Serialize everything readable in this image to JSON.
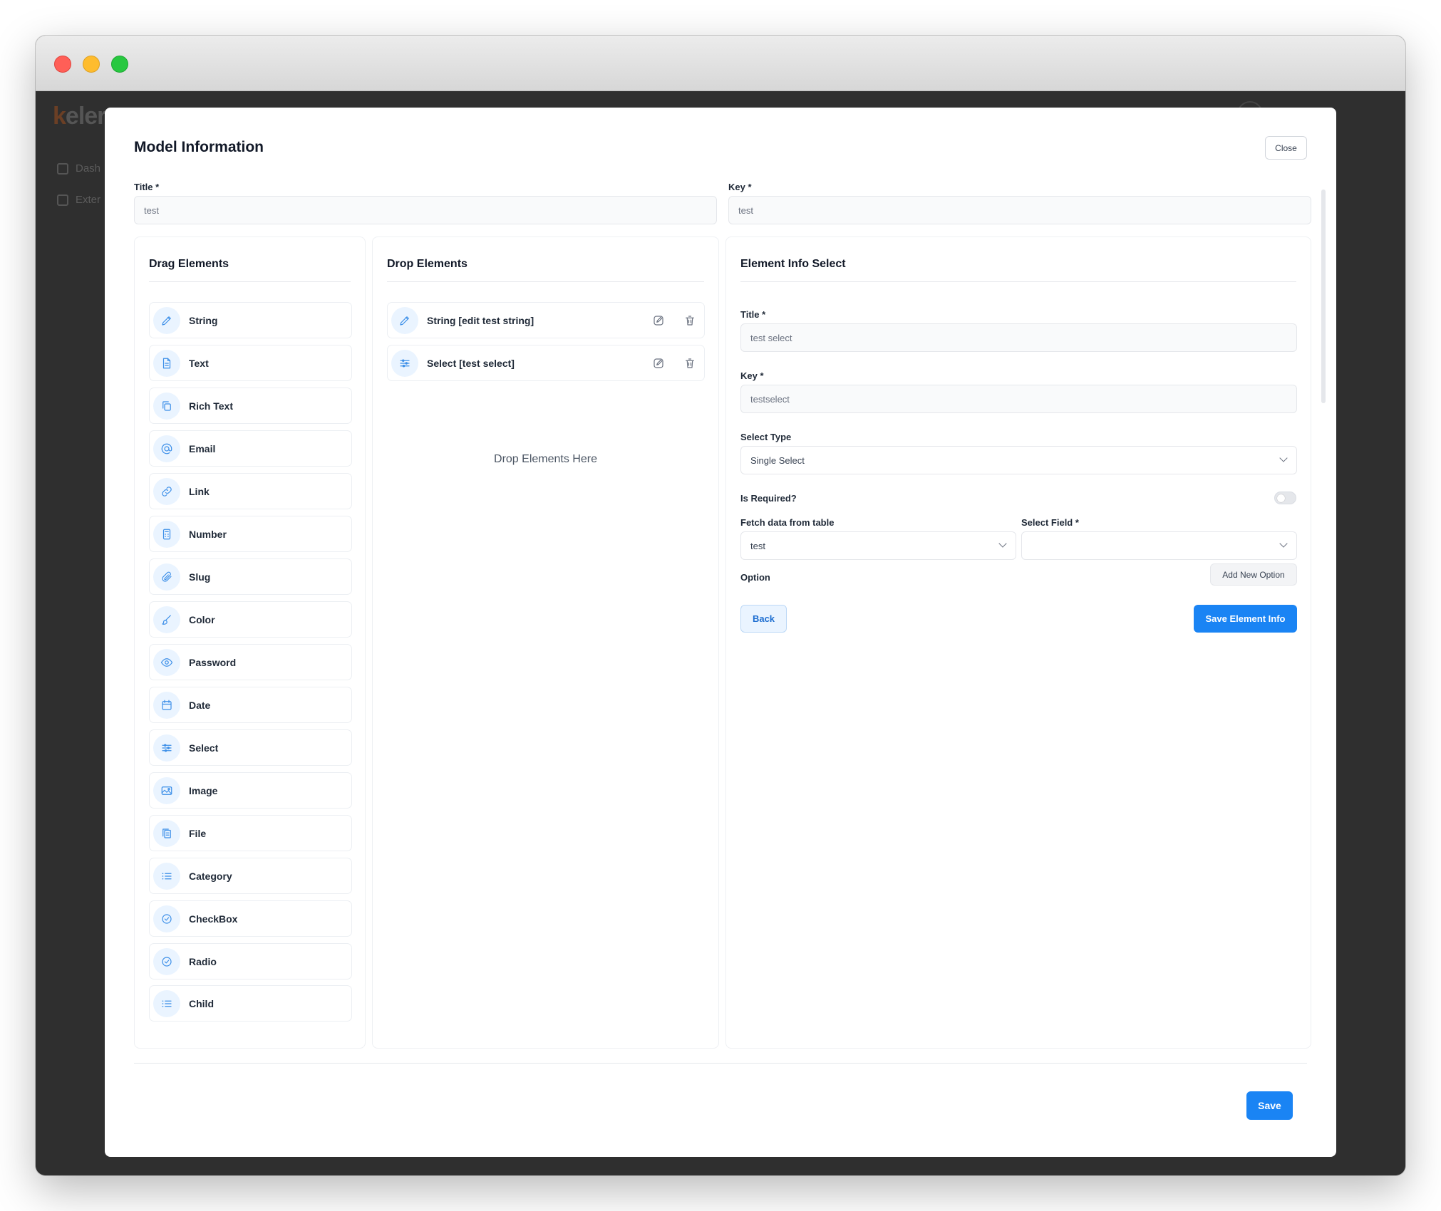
{
  "background_app": {
    "logo_text": "eler",
    "nav": [
      "Dash",
      "Exter"
    ]
  },
  "modal": {
    "title": "Model Information",
    "close_label": "Close",
    "title_field": {
      "label": "Title *",
      "value": "test"
    },
    "key_field": {
      "label": "Key *",
      "value": "test"
    },
    "save_label": "Save"
  },
  "drag_panel": {
    "title": "Drag Elements",
    "items": [
      {
        "label": "String",
        "icon": "pencil-icon"
      },
      {
        "label": "Text",
        "icon": "document-icon"
      },
      {
        "label": "Rich Text",
        "icon": "copy-icon"
      },
      {
        "label": "Email",
        "icon": "at-icon"
      },
      {
        "label": "Link",
        "icon": "link-icon"
      },
      {
        "label": "Number",
        "icon": "calculator-icon"
      },
      {
        "label": "Slug",
        "icon": "paperclip-icon"
      },
      {
        "label": "Color",
        "icon": "brush-icon"
      },
      {
        "label": "Password",
        "icon": "eye-icon"
      },
      {
        "label": "Date",
        "icon": "calendar-icon"
      },
      {
        "label": "Select",
        "icon": "sliders-icon"
      },
      {
        "label": "Image",
        "icon": "image-icon"
      },
      {
        "label": "File",
        "icon": "files-icon"
      },
      {
        "label": "Category",
        "icon": "list-icon"
      },
      {
        "label": "CheckBox",
        "icon": "check-circle-icon"
      },
      {
        "label": "Radio",
        "icon": "check-circle-icon"
      },
      {
        "label": "Child",
        "icon": "list-icon"
      }
    ]
  },
  "drop_panel": {
    "title": "Drop Elements",
    "items": [
      {
        "label": "String [edit test string]",
        "icon": "pencil-icon"
      },
      {
        "label": "Select [test select]",
        "icon": "sliders-icon"
      }
    ],
    "hint": "Drop Elements Here"
  },
  "info_panel": {
    "title": "Element Info Select",
    "title_label": "Title *",
    "title_value": "test select",
    "key_label": "Key *",
    "key_value": "testselect",
    "select_type_label": "Select Type",
    "select_type_value": "Single Select",
    "required_label": "Is Required?",
    "required_on": false,
    "fetch_label": "Fetch data from table",
    "fetch_value": "test",
    "select_field_label": "Select Field *",
    "select_field_value": "",
    "option_label": "Option",
    "add_option_label": "Add New Option",
    "back_label": "Back",
    "save_info_label": "Save Element Info"
  },
  "colors": {
    "primary": "#1a84f4",
    "icon_bg": "#eaf4ff",
    "icon": "#3b8ee8"
  }
}
